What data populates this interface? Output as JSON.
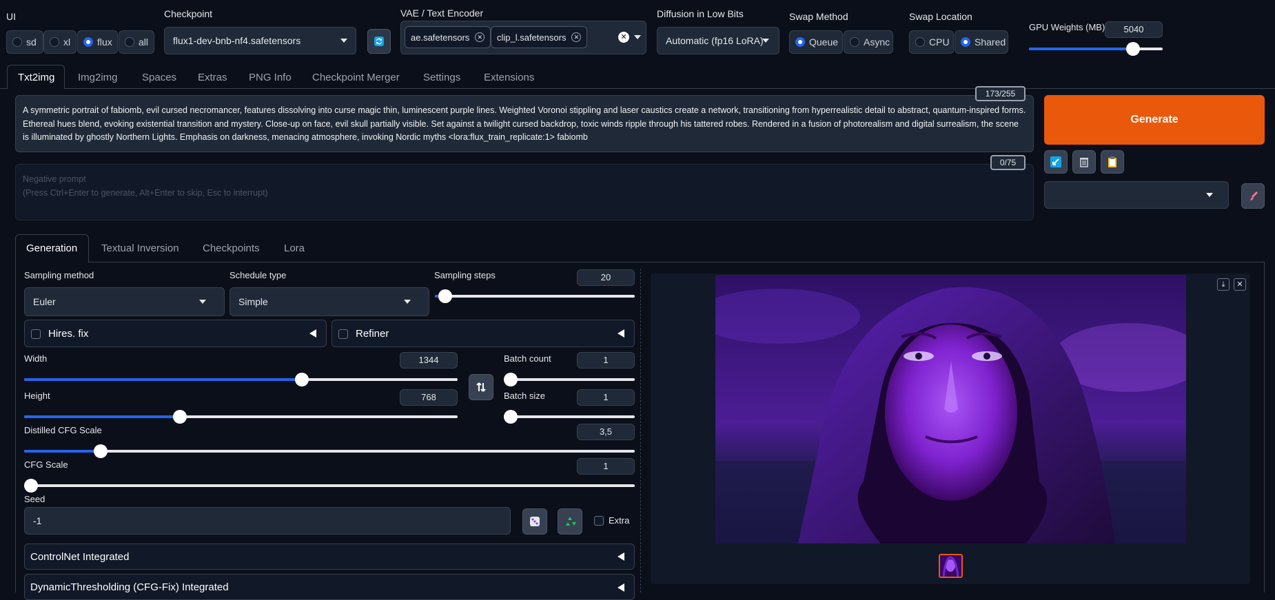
{
  "top": {
    "ui": {
      "label": "UI",
      "options": [
        "sd",
        "xl",
        "flux",
        "all"
      ],
      "selected": "flux"
    },
    "checkpoint": {
      "label": "Checkpoint",
      "value": "flux1-dev-bnb-nf4.safetensors"
    },
    "vae": {
      "label": "VAE / Text Encoder",
      "chips": [
        "ae.safetensors",
        "clip_l.safetensors"
      ]
    },
    "lowbits": {
      "label": "Diffusion in Low Bits",
      "value": "Automatic (fp16 LoRA)"
    },
    "swap_method": {
      "label": "Swap Method",
      "options": [
        "Queue",
        "Async"
      ],
      "selected": "Queue"
    },
    "swap_location": {
      "label": "Swap Location",
      "options": [
        "CPU",
        "Shared"
      ],
      "selected": "Shared"
    },
    "gpu_weights": {
      "label": "GPU Weights (MB)",
      "value": "5040",
      "fraction": 0.78
    }
  },
  "tabs": [
    "Txt2img",
    "Img2img",
    "Spaces",
    "Extras",
    "PNG Info",
    "Checkpoint Merger",
    "Settings",
    "Extensions"
  ],
  "prompt": {
    "text": "A symmetric portrait of fabiomb, evil cursed necromancer, features dissolving into curse magic thin, luminescent purple lines. Weighted Voronoi stippling and laser caustics create a network, transitioning from hyperrealistic detail to abstract, quantum-inspired forms. Ethereal hues blend, evoking existential transition and mystery. Close-up on face, evil skull partially visible. Set against a twilight cursed backdrop, toxic winds ripple through his tattered robes. Rendered in a fusion of photorealism and digital surrealism, the scene is illuminated by ghostly Northern Lights. Emphasis on darkness, menacing atmosphere, invoking Nordic myths <lora:flux_train_replicate:1> fabiomb",
    "counter": "173/255"
  },
  "negative": {
    "placeholder_line1": "Negative prompt",
    "placeholder_line2": "(Press Ctrl+Enter to generate, Alt+Enter to skip, Esc to interrupt)",
    "counter": "0/75"
  },
  "generate_label": "Generate",
  "subtabs": [
    "Generation",
    "Textual Inversion",
    "Checkpoints",
    "Lora"
  ],
  "gen": {
    "sampling_method": {
      "label": "Sampling method",
      "value": "Euler"
    },
    "schedule_type": {
      "label": "Schedule type",
      "value": "Simple"
    },
    "sampling_steps": {
      "label": "Sampling steps",
      "value": "20"
    },
    "hires_label": "Hires. fix",
    "refiner_label": "Refiner",
    "width": {
      "label": "Width",
      "value": "1344"
    },
    "height": {
      "label": "Height",
      "value": "768"
    },
    "batch_count": {
      "label": "Batch count",
      "value": "1"
    },
    "batch_size": {
      "label": "Batch size",
      "value": "1"
    },
    "distilled_cfg": {
      "label": "Distilled CFG Scale",
      "value": "3,5"
    },
    "cfg": {
      "label": "CFG Scale",
      "value": "1"
    },
    "seed": {
      "label": "Seed",
      "value": "-1"
    },
    "extra_label": "Extra",
    "controlnet_label": "ControlNet Integrated",
    "dynthresh_label": "DynamicThresholding (CFG-Fix) Integrated"
  },
  "slider_levels": {
    "sampling_steps": 0.05,
    "width": 0.64,
    "height": 0.36,
    "batch_count": 0.0,
    "batch_size": 0.0,
    "distilled_cfg": 0.125,
    "cfg": 0.0
  },
  "colors": {
    "accent": "#2563eb",
    "generate": "#ea580c",
    "background": "#0b0f19"
  }
}
